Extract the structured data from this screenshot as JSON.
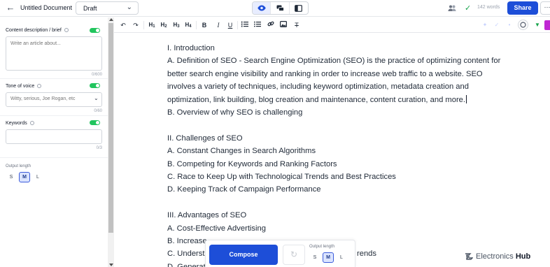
{
  "header": {
    "doc_title": "Untitled Document",
    "status": "Draft",
    "word_count": "142 words",
    "share_label": "Share",
    "more_label": "···"
  },
  "sidebar": {
    "content": {
      "label": "Content description / brief",
      "placeholder": "Write an article about...",
      "count": "0/600"
    },
    "tone": {
      "label": "Tone of voice",
      "placeholder": "Witty, serious, Joe Rogan, etc",
      "count": "0/60"
    },
    "keywords": {
      "label": "Keywords",
      "count": "0/3"
    },
    "length": {
      "label": "Output length",
      "options": [
        "S",
        "M",
        "L"
      ],
      "selected": "M"
    }
  },
  "toolbar": {
    "h1": "H",
    "h2": "H",
    "h3": "H",
    "h4": "H",
    "h1n": "1",
    "h2n": "2",
    "h3n": "3",
    "h4n": "4",
    "bold": "B",
    "italic": "I",
    "underline": "U",
    "clear": "T"
  },
  "editor": {
    "lines": [
      "I. Introduction",
      "A. Definition of SEO - Search Engine Optimization (SEO) is the practice of optimizing content for better search engine visibility and ranking in order to increase web traffic to a website. SEO involves a variety of techniques, including keyword optimization, metadata creation and optimization, link building, blog creation and maintenance, content curation, and more.",
      "B. Overview of why SEO is challenging",
      "",
      "II. Challenges of SEO",
      "A. Constant Changes in Search Algorithms",
      "B. Competing for Keywords and Ranking Factors",
      "C. Race to Keep Up with Technological Trends and Best Practices",
      "D. Keeping Track of Campaign Performance",
      "",
      "III. Advantages of SEO",
      "A. Cost-Effective Advertising",
      "B. Increase",
      "C. Underst",
      "D. Generati"
    ],
    "line13_tail": "rends"
  },
  "compose": {
    "button": "Compose",
    "length_label": "Output length",
    "options": [
      "S",
      "M",
      "L"
    ],
    "selected": "M"
  },
  "watermark": {
    "brand_a": "Electronics",
    "brand_b": "Hub"
  },
  "colors": {
    "primary": "#1d4ed8",
    "toggle": "#22c55e",
    "selected_bg": "#dbe4ff"
  }
}
